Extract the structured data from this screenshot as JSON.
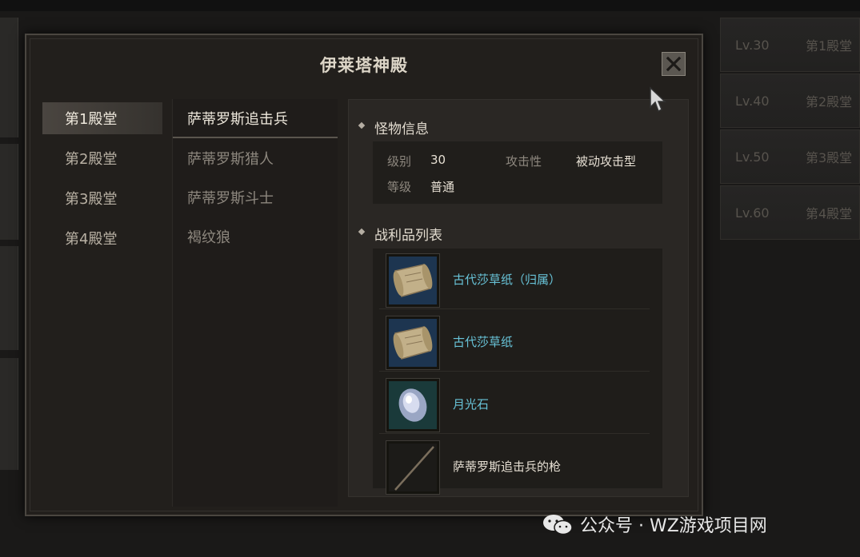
{
  "background": {
    "levels": [
      {
        "lv": "Lv.30",
        "hall": "第1殿堂"
      },
      {
        "lv": "Lv.40",
        "hall": "第2殿堂"
      },
      {
        "lv": "Lv.50",
        "hall": "第3殿堂"
      },
      {
        "lv": "Lv.60",
        "hall": "第4殿堂"
      }
    ]
  },
  "dialog": {
    "title": "伊莱塔神殿",
    "halls": [
      "第1殿堂",
      "第2殿堂",
      "第3殿堂",
      "第4殿堂"
    ],
    "selected_hall": "第1殿堂",
    "monsters": [
      "萨蒂罗斯追击兵",
      "萨蒂罗斯猎人",
      "萨蒂罗斯斗士",
      "褐纹狼"
    ],
    "selected_monster": "萨蒂罗斯追击兵",
    "monster_info": {
      "heading": "怪物信息",
      "level_label": "级别",
      "level_value": "30",
      "aggression_label": "攻击性",
      "aggression_value": "被动攻击型",
      "rank_label": "等级",
      "rank_value": "普通"
    },
    "loot": {
      "heading": "战利品列表",
      "items": [
        {
          "name": "古代莎草纸（归属）",
          "icon": "papyrus-scroll-icon",
          "color": "#68c3d8"
        },
        {
          "name": "古代莎草纸",
          "icon": "papyrus-scroll-icon",
          "color": "#68c3d8"
        },
        {
          "name": "月光石",
          "icon": "moonstone-icon",
          "color": "#68c3d8"
        },
        {
          "name": "萨蒂罗斯追击兵的枪",
          "icon": "spear-icon",
          "color": "#e6dfd3"
        }
      ]
    }
  },
  "watermark": "公众号 · WZ游戏项目网",
  "colors": {
    "rare_item": "#68c3d8",
    "common_item": "#e6dfd3",
    "panel_bg": "#221f1c"
  }
}
